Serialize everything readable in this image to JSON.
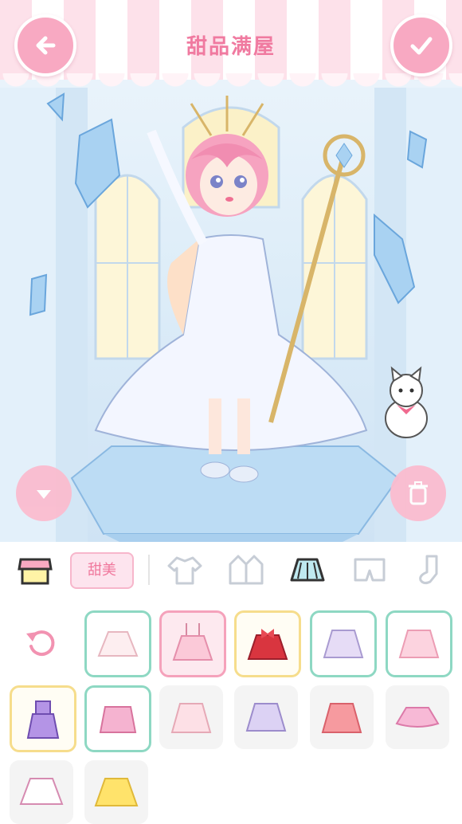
{
  "header": {
    "title": "甜品满屋"
  },
  "toolbar": {
    "tag_label": "甜美"
  },
  "icons": {
    "back": "arrow-left-icon",
    "confirm": "checkmark-icon",
    "hide": "chevron-down-icon",
    "delete": "trash-icon",
    "shop": "shop-icon",
    "reset": "undo-icon"
  },
  "colors": {
    "accent": "#f8a9c2",
    "title": "#f07aa0",
    "selected_border": "#f5a2bb",
    "owned_border": "#8ed8c3",
    "new_border": "#f6dd8c"
  }
}
